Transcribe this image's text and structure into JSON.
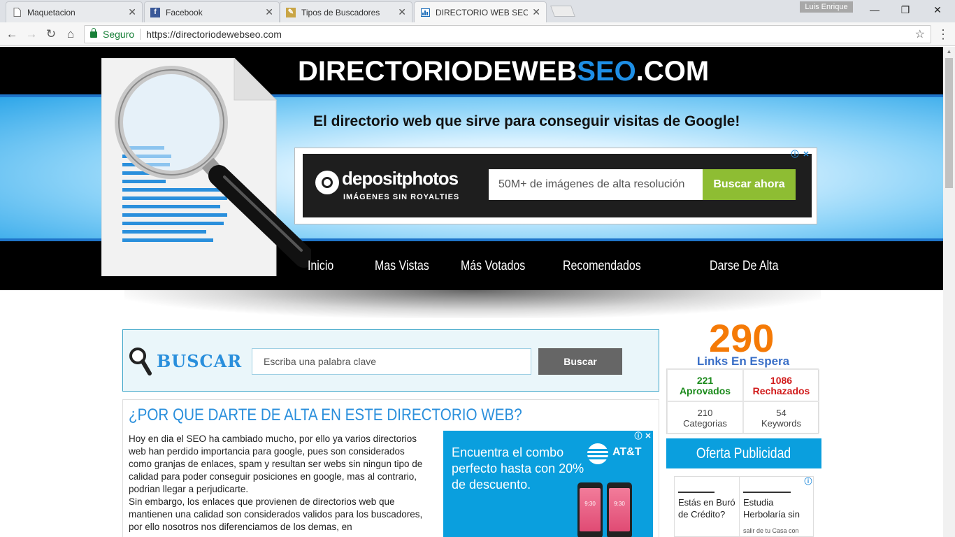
{
  "browser": {
    "tabs": [
      {
        "label": "Maquetacion",
        "icon": "page-icon"
      },
      {
        "label": "Facebook",
        "icon": "facebook-icon"
      },
      {
        "label": "Tipos de Buscadores",
        "icon": "bookmark-page-icon"
      },
      {
        "label": "DIRECTORIO WEB SEO -",
        "icon": "chart-icon"
      }
    ],
    "profile_name": "Luis Enrique",
    "security_label": "Seguro",
    "url": "https://directoriodewebseo.com"
  },
  "header": {
    "title_main": "DIRECTORIODEWEB",
    "title_accent": "SEO",
    "title_suffix": ".COM",
    "accent_color": "#1e8fe6",
    "tagline": "El directorio web que sirve para conseguir visitas de Google!"
  },
  "top_ad": {
    "brand": "depositphotos",
    "brand_sub": "IMÁGENES SIN ROYALTIES",
    "input_text": "50M+ de imágenes de alta resolución",
    "button_label": "Buscar ahora",
    "button_color": "#8ebd33"
  },
  "nav": {
    "items": [
      "Inicio",
      "Mas Vistas",
      "Más Votados",
      "Recomendados",
      "Darse De Alta"
    ]
  },
  "search": {
    "title": "BUSCAR",
    "placeholder": "Escriba una palabra clave",
    "button_label": "Buscar"
  },
  "article": {
    "title": "¿POR QUE DARTE DE ALTA EN ESTE DIRECTORIO WEB?",
    "paragraph1": "Hoy en dia el SEO ha cambiado mucho, por ello ya varios directorios web han perdido importancia para google, pues son considerados como granjas de enlaces, spam y resultan ser webs sin ningun tipo de calidad para poder conseguir posiciones en google, mas al contrario, podrian llegar a perjudicarte.",
    "paragraph2": "Sin embargo, los enlaces que provienen de directorios web que mantienen una calidad son considerados validos para los buscadores, por ello nosotros nos diferenciamos de los demas, en"
  },
  "att_ad": {
    "text": "Encuentra el combo perfecto hasta con 20% de descuento.",
    "brand": "AT&T",
    "phone_time": "9:30"
  },
  "stats": {
    "links_waiting": "290",
    "links_waiting_label": "Links En Espera",
    "approved_count": "221",
    "approved_label": "Aprovados",
    "rejected_count": "1086",
    "rejected_label": "Rechazados",
    "categories_count": "210",
    "categories_label": "Categorias",
    "keywords_count": "54",
    "keywords_label": "Keywords",
    "orange": "#f57a06"
  },
  "sidebar": {
    "offer_label": "Oferta Publicidad",
    "ad_left_title": "Estás en Buró de Crédito?",
    "ad_right_title": "Estudia Herbolaría sin",
    "ad_right_small": "salir de tu Casa con"
  }
}
